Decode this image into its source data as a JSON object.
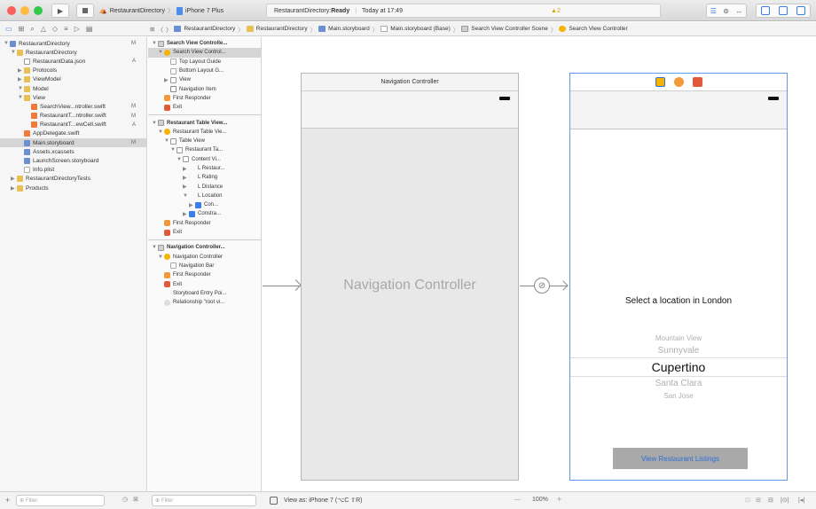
{
  "titlebar": {
    "scheme": "RestaurantDirectory",
    "device": "iPhone 7 Plus",
    "status_prefix": "RestaurantDirectory: ",
    "status_state": "Ready",
    "status_time": "Today at 17:49",
    "warning_count": "2",
    "colors": {
      "close": "#fc605c",
      "minimize": "#fdbc40",
      "zoom": "#34c84a"
    }
  },
  "jumpbar": {
    "items": [
      "RestaurantDirectory",
      "RestaurantDirectory",
      "Main.storyboard",
      "Main.storyboard (Base)",
      "Search View Controller Scene",
      "Search View Controller"
    ]
  },
  "navigator": {
    "items": [
      {
        "label": "RestaurantDirectory",
        "flag": "M",
        "indent": 0,
        "icon": "project-icon",
        "open": true
      },
      {
        "label": "RestaurantDirectory",
        "flag": "",
        "indent": 1,
        "icon": "folder-icon",
        "open": true
      },
      {
        "label": "RestaurantData.json",
        "flag": "A",
        "indent": 2,
        "icon": "json-file-icon"
      },
      {
        "label": "Protocols",
        "flag": "",
        "indent": 2,
        "icon": "folder-icon",
        "closed": true
      },
      {
        "label": "ViewModel",
        "flag": "",
        "indent": 2,
        "icon": "folder-icon",
        "closed": true
      },
      {
        "label": "Model",
        "flag": "",
        "indent": 2,
        "icon": "folder-icon",
        "open": true
      },
      {
        "label": "View",
        "flag": "",
        "indent": 2,
        "icon": "folder-icon",
        "open": true
      },
      {
        "label": "SearchView...ntroller.swift",
        "flag": "M",
        "indent": 3,
        "icon": "swift-file-icon"
      },
      {
        "label": "RestaurantT...ntroller.swift",
        "flag": "M",
        "indent": 3,
        "icon": "swift-file-icon"
      },
      {
        "label": "RestaurantT...ewCell.swift",
        "flag": "A",
        "indent": 3,
        "icon": "swift-file-icon"
      },
      {
        "label": "AppDelegate.swift",
        "flag": "",
        "indent": 2,
        "icon": "swift-file-icon"
      },
      {
        "label": "Main.storyboard",
        "flag": "M",
        "indent": 2,
        "icon": "storyboard-icon",
        "selected": true
      },
      {
        "label": "Assets.xcassets",
        "flag": "",
        "indent": 2,
        "icon": "assets-icon"
      },
      {
        "label": "LaunchScreen.storyboard",
        "flag": "",
        "indent": 2,
        "icon": "storyboard-icon"
      },
      {
        "label": "Info.plist",
        "flag": "",
        "indent": 2,
        "icon": "plist-icon"
      },
      {
        "label": "RestaurantDirectoryTests",
        "flag": "",
        "indent": 1,
        "icon": "folder-icon",
        "closed": true
      },
      {
        "label": "Products",
        "flag": "",
        "indent": 1,
        "icon": "folder-icon",
        "closed": true
      }
    ],
    "filter_placeholder": "Filter"
  },
  "outline": {
    "items": [
      {
        "label": "Search View Controlle...",
        "indent": 0,
        "head": true,
        "icon": "scene-icon",
        "open": true
      },
      {
        "label": "Search View Control...",
        "indent": 1,
        "icon": "view-controller-icon",
        "open": true,
        "selected": true
      },
      {
        "label": "Top Layout Guide",
        "indent": 2,
        "icon": "layout-guide-icon"
      },
      {
        "label": "Bottom Layout G...",
        "indent": 2,
        "icon": "layout-guide-icon"
      },
      {
        "label": "View",
        "indent": 2,
        "icon": "view-icon",
        "closed": true
      },
      {
        "label": "Navigation Item",
        "indent": 2,
        "icon": "navigation-item-icon"
      },
      {
        "label": "First Responder",
        "indent": 1,
        "icon": "first-responder-icon"
      },
      {
        "label": "Exit",
        "indent": 1,
        "icon": "exit-icon"
      },
      {
        "sep": true
      },
      {
        "label": "Restaurant Table View...",
        "indent": 0,
        "head": true,
        "icon": "scene-icon",
        "open": true
      },
      {
        "label": "Restaurant Table Vie...",
        "indent": 1,
        "icon": "view-controller-icon",
        "open": true
      },
      {
        "label": "Table View",
        "indent": 2,
        "icon": "table-view-icon",
        "open": true
      },
      {
        "label": "Restaurant Ta...",
        "indent": 3,
        "icon": "cell-icon",
        "open": true
      },
      {
        "label": "Content Vi...",
        "indent": 4,
        "icon": "view-icon",
        "open": true
      },
      {
        "label": "L  Restaur...",
        "indent": 5,
        "icon": "label-icon",
        "closed": true
      },
      {
        "label": "L  Rating",
        "indent": 5,
        "icon": "label-icon",
        "closed": true
      },
      {
        "label": "L  Distance",
        "indent": 5,
        "icon": "label-icon",
        "closed": true
      },
      {
        "label": "L  Location",
        "indent": 5,
        "icon": "label-icon",
        "open": true
      },
      {
        "label": "Con...",
        "indent": 6,
        "icon": "constraints-icon",
        "closed": true
      },
      {
        "label": "Constra...",
        "indent": 5,
        "icon": "constraints-icon",
        "closed": true
      },
      {
        "label": "First Responder",
        "indent": 1,
        "icon": "first-responder-icon"
      },
      {
        "label": "Exit",
        "indent": 1,
        "icon": "exit-icon"
      },
      {
        "sep": true
      },
      {
        "label": "Navigation Controller...",
        "indent": 0,
        "head": true,
        "icon": "scene-icon",
        "open": true
      },
      {
        "label": "Navigation Controller",
        "indent": 1,
        "icon": "navigation-controller-icon",
        "open": true
      },
      {
        "label": "Navigation Bar",
        "indent": 2,
        "icon": "navigation-bar-icon"
      },
      {
        "label": "First Responder",
        "indent": 1,
        "icon": "first-responder-icon"
      },
      {
        "label": "Exit",
        "indent": 1,
        "icon": "exit-icon"
      },
      {
        "label": "Storyboard Entry Poi...",
        "indent": 1,
        "icon": "entry-point-icon"
      },
      {
        "label": "Relationship \"root vi...",
        "indent": 1,
        "icon": "relationship-icon"
      }
    ],
    "filter_placeholder": "Filter"
  },
  "canvas": {
    "nav_controller": {
      "title": "Navigation Controller",
      "placeholder": "Navigation Controller"
    },
    "search_vc": {
      "prompt": "Select a location in London",
      "picker": [
        "Mountain View",
        "Sunnyvale",
        "Cupertino",
        "Santa Clara",
        "San Jose"
      ],
      "picker_selected_index": 2,
      "button_label": "View Restaurant Listings"
    }
  },
  "bottombar": {
    "view_as": "View as: iPhone 7 (⌥C ⇧R)",
    "zoom": "100%",
    "minus": "—",
    "plus": "+"
  }
}
